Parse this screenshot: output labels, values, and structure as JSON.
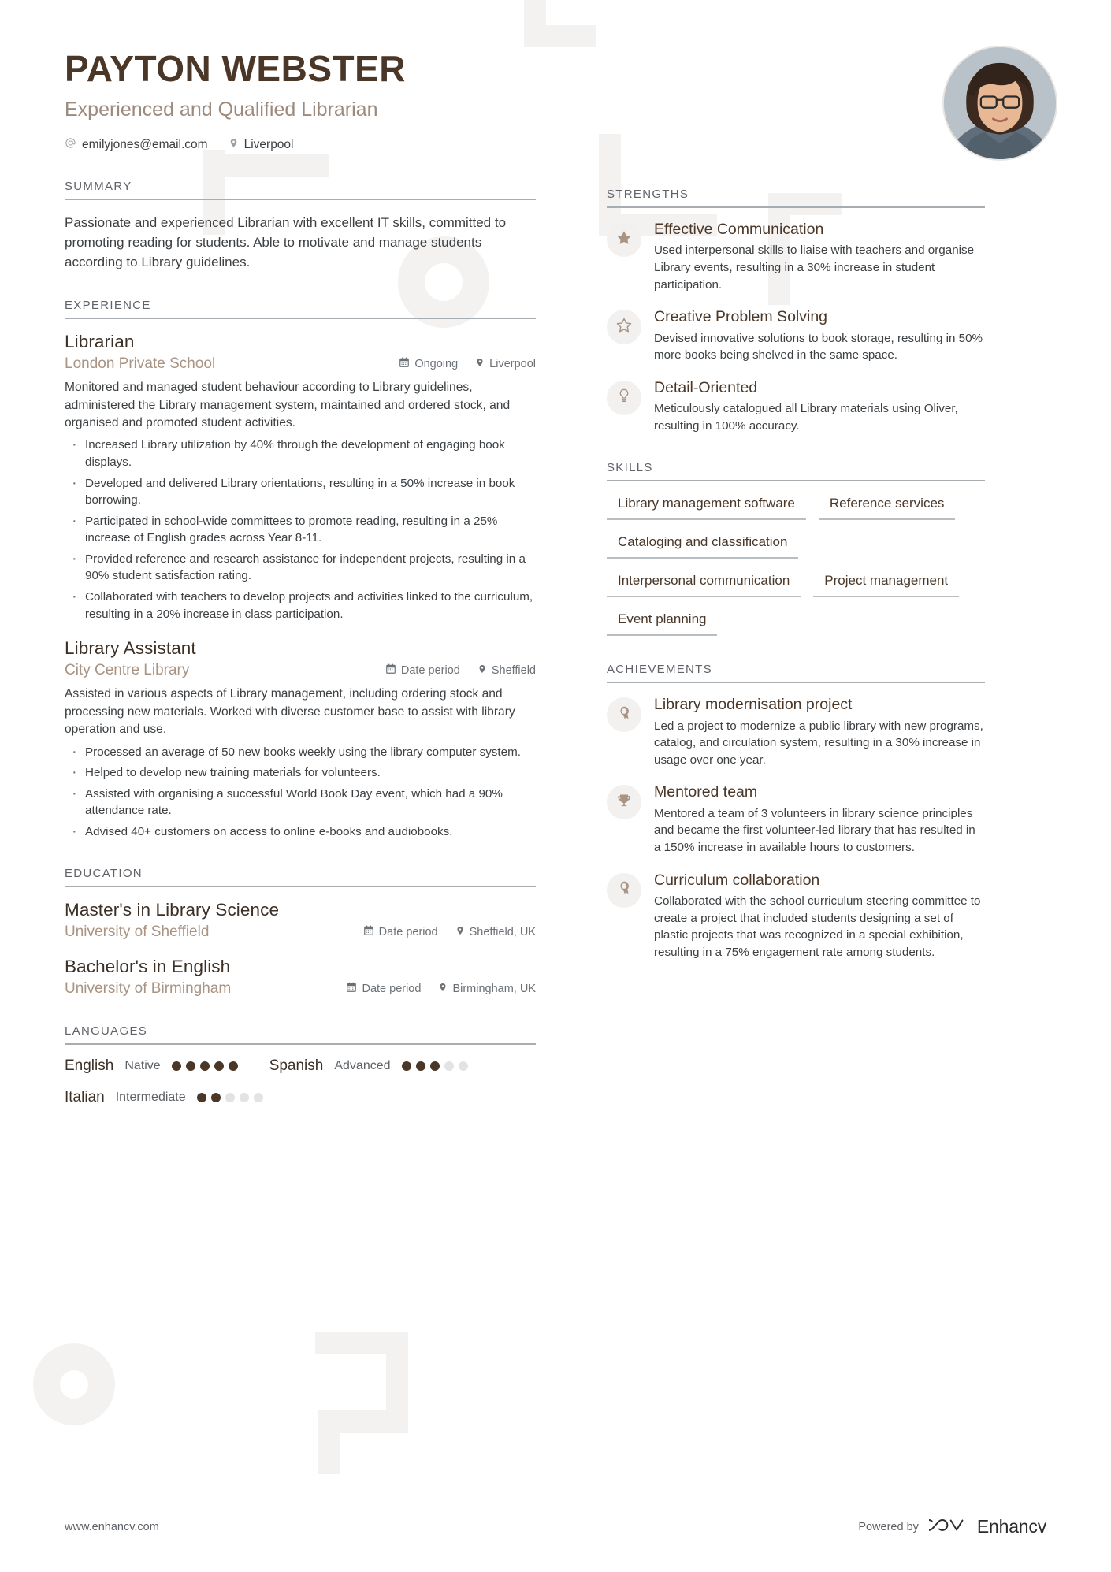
{
  "header": {
    "name": "PAYTON WEBSTER",
    "headline": "Experienced and Qualified Librarian",
    "email": "emilyjones@email.com",
    "location": "Liverpool"
  },
  "summary": {
    "title": "SUMMARY",
    "text": "Passionate and experienced Librarian with excellent IT skills, committed to promoting reading for students. Able to motivate and manage students according to Library guidelines."
  },
  "experience": {
    "title": "EXPERIENCE",
    "entries": [
      {
        "role": "Librarian",
        "org": "London Private School",
        "date": "Ongoing",
        "place": "Liverpool",
        "desc": "Monitored and managed student behaviour according to Library guidelines, administered the Library management system, maintained and ordered stock, and organised and promoted student activities.",
        "bullets": [
          "Increased Library utilization by 40% through the development of engaging book displays.",
          "Developed and delivered Library orientations, resulting in a 50% increase in book borrowing.",
          "Participated in school-wide committees to promote reading, resulting in a 25% increase of English grades across Year 8-11.",
          "Provided reference and research assistance for independent projects, resulting in a 90% student satisfaction rating.",
          "Collaborated with teachers to develop projects and activities linked to the curriculum, resulting in a 20% increase in class participation."
        ]
      },
      {
        "role": "Library Assistant",
        "org": "City Centre Library",
        "date": "Date period",
        "place": "Sheffield",
        "desc": "Assisted in various aspects of Library management, including ordering stock and processing new materials. Worked with diverse customer base to assist with library operation and use.",
        "bullets": [
          "Processed an average of 50 new books weekly using the library computer system.",
          "Helped to develop new training materials for volunteers.",
          "Assisted with organising a successful World Book Day event, which had a 90% attendance rate.",
          "Advised 40+ customers on access to online e-books and audiobooks."
        ]
      }
    ]
  },
  "education": {
    "title": "EDUCATION",
    "entries": [
      {
        "degree": "Master's in Library Science",
        "school": "University of Sheffield",
        "date": "Date period",
        "place": "Sheffield, UK"
      },
      {
        "degree": "Bachelor's in English",
        "school": "University of Birmingham",
        "date": "Date period",
        "place": "Birmingham, UK"
      }
    ]
  },
  "languages": {
    "title": "LANGUAGES",
    "items": [
      {
        "name": "English",
        "level": "Native",
        "rating": 5,
        "max": 5
      },
      {
        "name": "Spanish",
        "level": "Advanced",
        "rating": 3,
        "max": 5
      },
      {
        "name": "Italian",
        "level": "Intermediate",
        "rating": 2,
        "max": 5
      }
    ]
  },
  "strengths": {
    "title": "STRENGTHS",
    "items": [
      {
        "icon": "star-filled-icon",
        "title": "Effective Communication",
        "desc": "Used interpersonal skills to liaise with teachers and organise Library events, resulting in a 30% increase in student participation."
      },
      {
        "icon": "star-outline-icon",
        "title": "Creative Problem Solving",
        "desc": "Devised innovative solutions to book storage, resulting in 50% more books being shelved in the same space."
      },
      {
        "icon": "lightbulb-icon",
        "title": "Detail-Oriented",
        "desc": "Meticulously catalogued all Library materials using Oliver, resulting in 100% accuracy."
      }
    ]
  },
  "skills": {
    "title": "SKILLS",
    "items": [
      "Library management software",
      "Reference services",
      "Cataloging and classification",
      "Interpersonal communication",
      "Project management",
      "Event planning"
    ]
  },
  "achievements": {
    "title": "ACHIEVEMENTS",
    "items": [
      {
        "icon": "award-icon",
        "title": "Library modernisation project",
        "desc": "Led a project to modernize a public library with new programs, catalog, and circulation system, resulting in a 30% increase in usage over one year."
      },
      {
        "icon": "trophy-icon",
        "title": "Mentored team",
        "desc": "Mentored a team of 3 volunteers in library science principles and became the first volunteer-led library that has resulted in a 150% increase in available hours to customers."
      },
      {
        "icon": "award-icon",
        "title": "Curriculum collaboration",
        "desc": "Collaborated with the school curriculum steering committee to create a project that included students designing a set of plastic projects that was recognized in a special exhibition, resulting in a 75% engagement rate among students."
      }
    ]
  },
  "footer": {
    "url": "www.enhancv.com",
    "powered_by": "Powered by",
    "brand": "Enhancv"
  },
  "colors": {
    "name_brown": "#4a3728",
    "accent_tan": "#a99382",
    "rule_gray": "#a8adb2",
    "body_text": "#3c4043",
    "deco": "#f4f2f0"
  }
}
